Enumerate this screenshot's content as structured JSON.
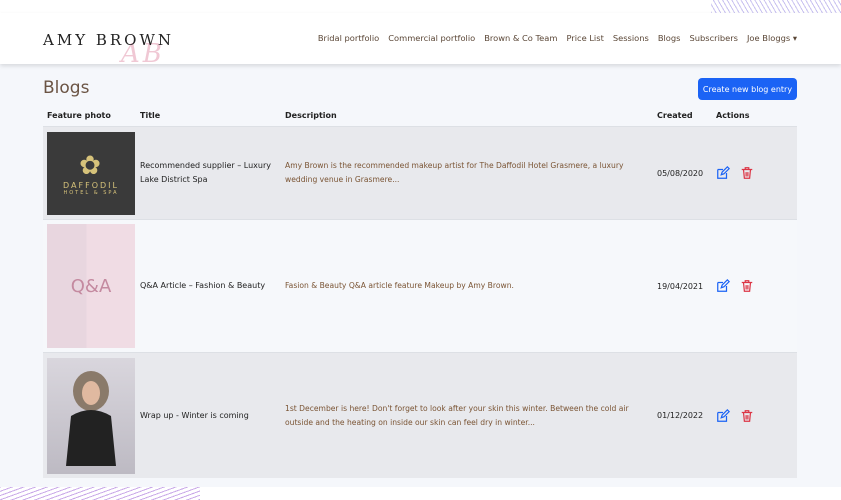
{
  "header": {
    "logo": "AMY BROWN",
    "monogram": "AB",
    "nav": [
      "Bridal portfolio",
      "Commercial portfolio",
      "Brown & Co Team",
      "Price List",
      "Sessions",
      "Blogs",
      "Subscribers",
      "Joe Bloggs"
    ]
  },
  "page": {
    "title": "Blogs",
    "create_button": "Create new blog entry"
  },
  "table": {
    "headers": [
      "Feature photo",
      "Title",
      "Description",
      "Created",
      "Actions"
    ],
    "rows": [
      {
        "photo_text": "DAFFODIL",
        "photo_sub": "HOTEL & SPA",
        "title": "Recommended supplier – Luxury Lake District Spa",
        "description": "Amy Brown is the recommended makeup artist for The Daffodil Hotel Grasmere, a luxury wedding venue in Grasmere...",
        "created": "05/08/2020"
      },
      {
        "photo_text": "Q&A",
        "title": "Q&A Article – Fashion & Beauty",
        "description": "Fasion & Beauty Q&A article feature Makeup by Amy Brown.",
        "created": "19/04/2021"
      },
      {
        "title": "Wrap up - Winter is coming",
        "description": "1st December is here! Don't forget to look after your skin this winter. Between the cold air outside and the heating on inside our skin can feel dry in winter...",
        "created": "01/12/2022"
      }
    ]
  },
  "colors": {
    "primary": "#1b63f5",
    "danger": "#dc3545",
    "edit": "#1b63f5"
  }
}
